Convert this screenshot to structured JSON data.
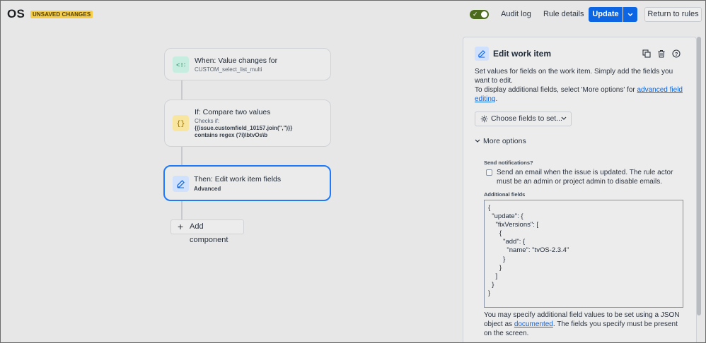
{
  "header": {
    "app_title": "OS",
    "unsaved_badge": "UNSAVED CHANGES",
    "audit_log": "Audit log",
    "rule_details": "Rule details",
    "update_label": "Update",
    "return_label": "Return to rules",
    "rule_enabled": true
  },
  "flow": {
    "trigger": {
      "title": "When: Value changes for",
      "subtitle": "CUSTOM_select_list_multi",
      "icon": "trigger-icon",
      "color": "#c6ede0"
    },
    "condition": {
      "title": "If: Compare two values",
      "checks_label": "Checks if:",
      "line1": "{{issue.customfield_10157.join(\",\")}}",
      "line2": "contains regex (?i)\\btvOs\\b",
      "icon": "braces-icon",
      "color": "#f8e6a0"
    },
    "action": {
      "title": "Then: Edit work item fields",
      "subtitle": "Advanced",
      "icon": "edit-icon",
      "color": "#cfe1fd"
    },
    "add_component": "Add component"
  },
  "panel": {
    "title": "Edit work item",
    "desc1": "Set values for fields on the work item. Simply add the fields you want to edit.",
    "desc2_prefix": "To display additional fields, select 'More options' for ",
    "desc2_link": "advanced field editing",
    "desc2_suffix": ".",
    "choose_fields": "Choose fields to set...",
    "more_options": "More options",
    "send_notifications_label": "Send notifications?",
    "send_email_text": "Send an email when the issue is updated. The rule actor must be an admin or project admin to disable emails.",
    "send_email_checked": false,
    "additional_fields_label": "Additional fields",
    "json_value": "{\n  \"update\": {\n    \"fixVersions\": [\n      {\n        \"add\": {\n          \"name\": \"tvOS-2.3.4\"\n        }\n      }\n    ]\n  }\n}",
    "foot_prefix": "You may specify additional field values to be set using a JSON object as ",
    "foot_link": "documented",
    "foot_suffix": ". The fields you specify must be present on the screen."
  },
  "colors": {
    "accent": "#0c66e4",
    "badge": "#f5cd47",
    "toggle_on": "#4c6b1f"
  }
}
